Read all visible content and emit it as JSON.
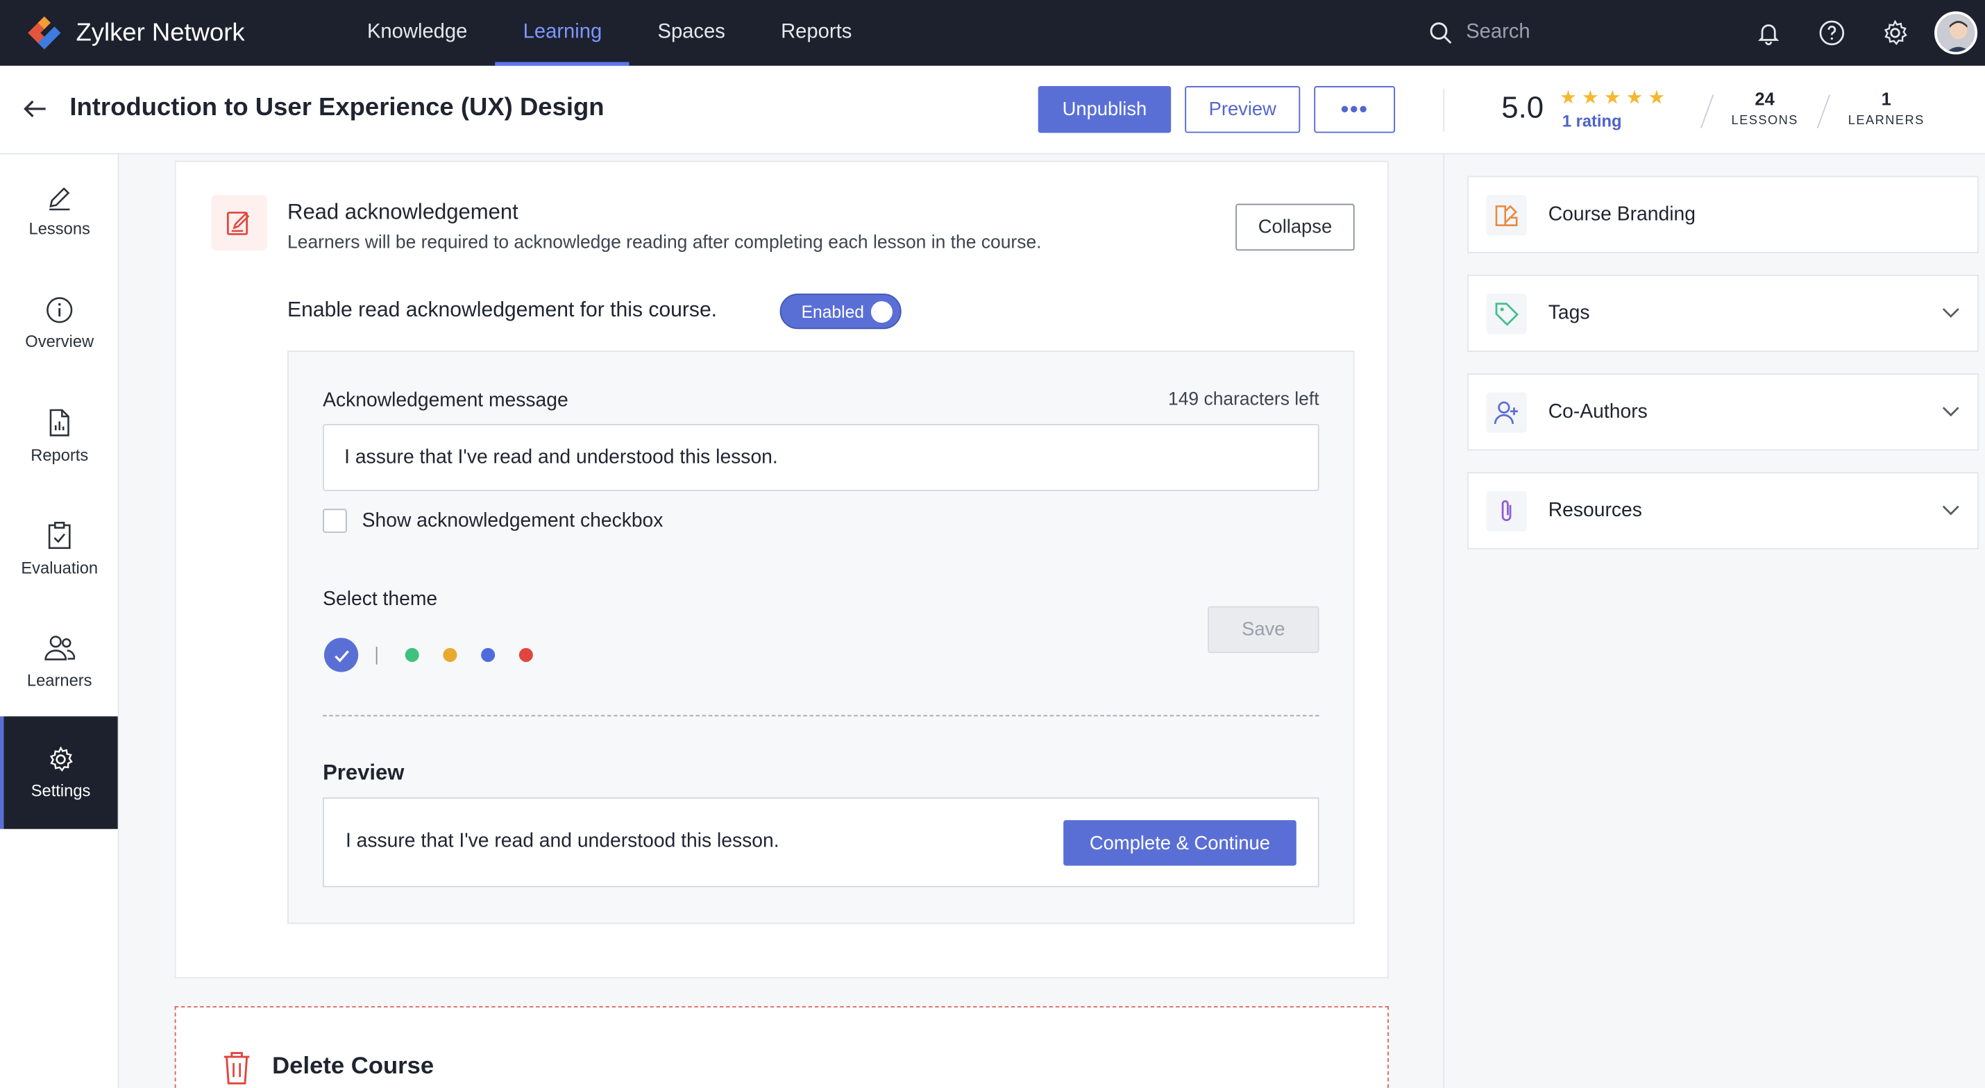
{
  "app": {
    "name": "Zylker Network",
    "nav": [
      {
        "label": "Knowledge"
      },
      {
        "label": "Learning"
      },
      {
        "label": "Spaces"
      },
      {
        "label": "Reports"
      }
    ],
    "active_nav": "Learning",
    "search_placeholder": "Search"
  },
  "header": {
    "title": "Introduction to User Experience (UX) Design",
    "unpublish_label": "Unpublish",
    "preview_label": "Preview",
    "more_label": "•••",
    "rating": "5.0",
    "stars": 5,
    "rating_count": "1 rating",
    "lessons_count": "24",
    "lessons_label": "LESSONS",
    "learners_count": "1",
    "learners_label": "LEARNERS"
  },
  "sidebar": {
    "items": [
      {
        "label": "Lessons",
        "icon": "pencil-icon"
      },
      {
        "label": "Overview",
        "icon": "info-icon"
      },
      {
        "label": "Reports",
        "icon": "report-icon"
      },
      {
        "label": "Evaluation",
        "icon": "clipboard-check-icon"
      },
      {
        "label": "Learners",
        "icon": "people-icon"
      },
      {
        "label": "Settings",
        "icon": "gear-icon"
      }
    ],
    "active": "Settings"
  },
  "read_ack": {
    "title": "Read acknowledgement",
    "description": "Learners will be required to acknowledge reading after completing each lesson in the course.",
    "collapse_label": "Collapse",
    "enable_label": "Enable read acknowledgement for this course.",
    "toggle_label": "Enabled",
    "toggle_on": true,
    "message_label": "Acknowledgement message",
    "chars_left": "149 characters left",
    "message_value": "I assure that I've read and understood this lesson.",
    "checkbox_label": "Show acknowledgement checkbox",
    "checkbox_checked": false,
    "theme_label": "Select theme",
    "themes": [
      {
        "color": "#5a6fd6",
        "selected": true
      },
      {
        "color": "#3fc17f",
        "selected": false
      },
      {
        "color": "#e8a92e",
        "selected": false
      },
      {
        "color": "#4d6bdb",
        "selected": false
      },
      {
        "color": "#e0463e",
        "selected": false
      }
    ],
    "save_label": "Save",
    "preview_label": "Preview",
    "preview_text": "I assure that I've read and understood this lesson.",
    "complete_label": "Complete & Continue"
  },
  "delete": {
    "title": "Delete Course"
  },
  "right_panel": {
    "items": [
      {
        "label": "Course Branding",
        "icon": "branding-icon",
        "expandable": false
      },
      {
        "label": "Tags",
        "icon": "tag-icon",
        "expandable": true
      },
      {
        "label": "Co-Authors",
        "icon": "add-person-icon",
        "expandable": true
      },
      {
        "label": "Resources",
        "icon": "paperclip-icon",
        "expandable": true
      }
    ]
  },
  "colors": {
    "accent": "#5a6fd6",
    "nav_bg": "#1c212d",
    "danger": "#e0615a",
    "star": "#f5b731"
  }
}
